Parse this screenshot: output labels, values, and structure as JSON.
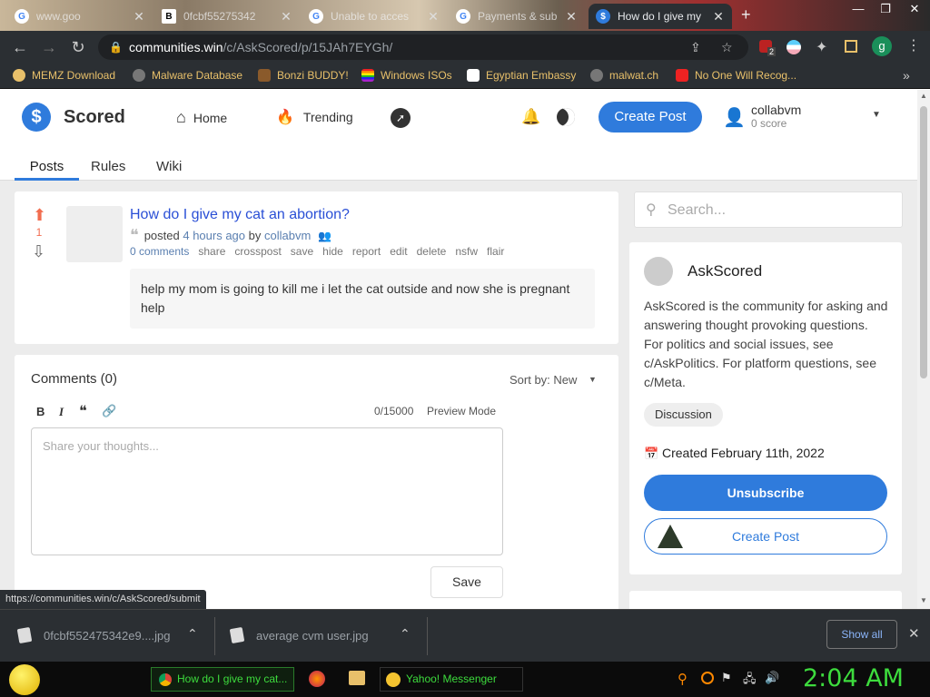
{
  "browser": {
    "tabs": [
      {
        "title": "www.goo",
        "fav": "G"
      },
      {
        "title": "0fcbf55275342",
        "fav": "B"
      },
      {
        "title": "Unable to acces",
        "fav": "G"
      },
      {
        "title": "Payments & sub",
        "fav": "G"
      },
      {
        "title": "How do I give my",
        "fav": "$"
      }
    ],
    "new_tab": "+",
    "url_host": "communities.win",
    "url_path": "/c/AskScored/p/15JAh7EYGh/",
    "profile_letter": "g",
    "ext_badge": "2",
    "bookmarks": [
      "MEMZ Download",
      "Malware Database",
      "Bonzi BUDDY!",
      "Windows ISOs",
      "Egyptian Embassy",
      "malwat.ch",
      "No One Will Recog..."
    ],
    "bookmarks_more": "»",
    "status_url": "https://communities.win/c/AskScored/submit"
  },
  "site": {
    "logo_text": "Scored",
    "nav_home": "Home",
    "nav_trending": "Trending",
    "create_post": "Create Post",
    "username": "collabvm",
    "user_score": "0 score",
    "subnav": [
      "Posts",
      "Rules",
      "Wiki"
    ]
  },
  "post": {
    "score": "1",
    "title": "How do I give my cat an abortion?",
    "posted": "posted",
    "time": "4 hours ago",
    "by": "by",
    "author": "collabvm",
    "actions": [
      "0 comments",
      "share",
      "crosspost",
      "save",
      "hide",
      "report",
      "edit",
      "delete",
      "nsfw",
      "flair"
    ],
    "body": "help my mom is going to kill me i let the cat outside and now she is pregnant help"
  },
  "comments": {
    "header": "Comments (0)",
    "sort_label": "Sort by: New",
    "char_count": "0/15000",
    "preview": "Preview Mode",
    "placeholder": "Share your thoughts...",
    "save": "Save"
  },
  "sidebar": {
    "search_placeholder": "Search...",
    "community": "AskScored",
    "description": "AskScored is the community for asking and answering thought provoking questions. For politics and social issues, see c/AskPolitics. For platform questions, see c/Meta.",
    "tag": "Discussion",
    "created": "Created February 11th, 2022",
    "unsubscribe": "Unsubscribe",
    "create_post": "Create Post"
  },
  "downloads": {
    "items": [
      "0fcbf552475342e9....jpg",
      "average cvm user.jpg"
    ],
    "show_all": "Show all"
  },
  "taskbar": {
    "items": [
      "How do I give my cat...",
      "Yahoo! Messenger"
    ],
    "clock": "2:04 AM"
  },
  "colors": {
    "accent": "#2f7bdc",
    "upvote": "#f26d4f",
    "clock": "#3ddc3d"
  }
}
